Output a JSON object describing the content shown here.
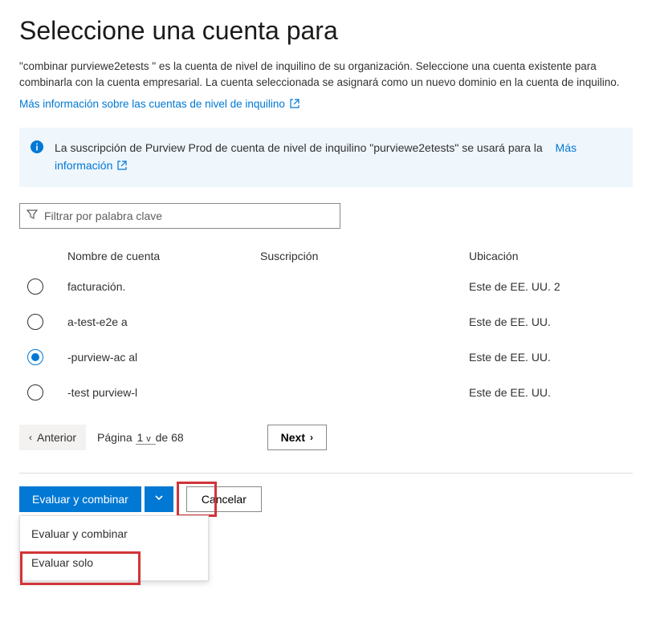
{
  "header": {
    "title": "Seleccione una cuenta para",
    "description_pre": "\"combinar ",
    "tenant_name": "purviewe2etests",
    "description_text": " \" es la cuenta de nivel de inquilino de su organización. Seleccione una cuenta existente para combinarla con la cuenta empresarial. La cuenta seleccionada se asignará como un nuevo dominio en la cuenta de inquilino.",
    "learn_more": "Más información sobre las cuentas de nivel de inquilino"
  },
  "info": {
    "text_pre": "La suscripción de Purview Prod de cuenta de nivel de inquilino \"",
    "tenant_name": "purviewe2etests",
    "text_post": "\" se usará para la",
    "learn_more": "Más información"
  },
  "filter": {
    "placeholder": "Filtrar por palabra clave"
  },
  "columns": {
    "name": "Nombre de cuenta",
    "subscription": "Suscripción",
    "location": "Ubicación"
  },
  "rows": [
    {
      "name": "facturación.",
      "subscription": "",
      "location": "Este de EE. UU. 2",
      "selected": false
    },
    {
      "name": "a-test-e2e a",
      "subscription": "",
      "location": "Este de EE. UU.",
      "selected": false
    },
    {
      "name": "-purview-ac al",
      "subscription": "",
      "location": "Este de EE. UU.",
      "selected": true
    },
    {
      "name": "-test purview-l",
      "subscription": "",
      "location": "Este de EE. UU.",
      "selected": false
    }
  ],
  "pagination": {
    "prev": "Anterior",
    "page_label_pre": "Página",
    "current": "1",
    "page_dropdown_marker": "v",
    "page_label_mid": "de",
    "total": "68",
    "next": "Next"
  },
  "footer": {
    "primary": "Evaluar y combinar",
    "cancel": "Cancelar",
    "menu": {
      "item1": "Evaluar y combinar",
      "item2": "Evaluar solo"
    }
  }
}
